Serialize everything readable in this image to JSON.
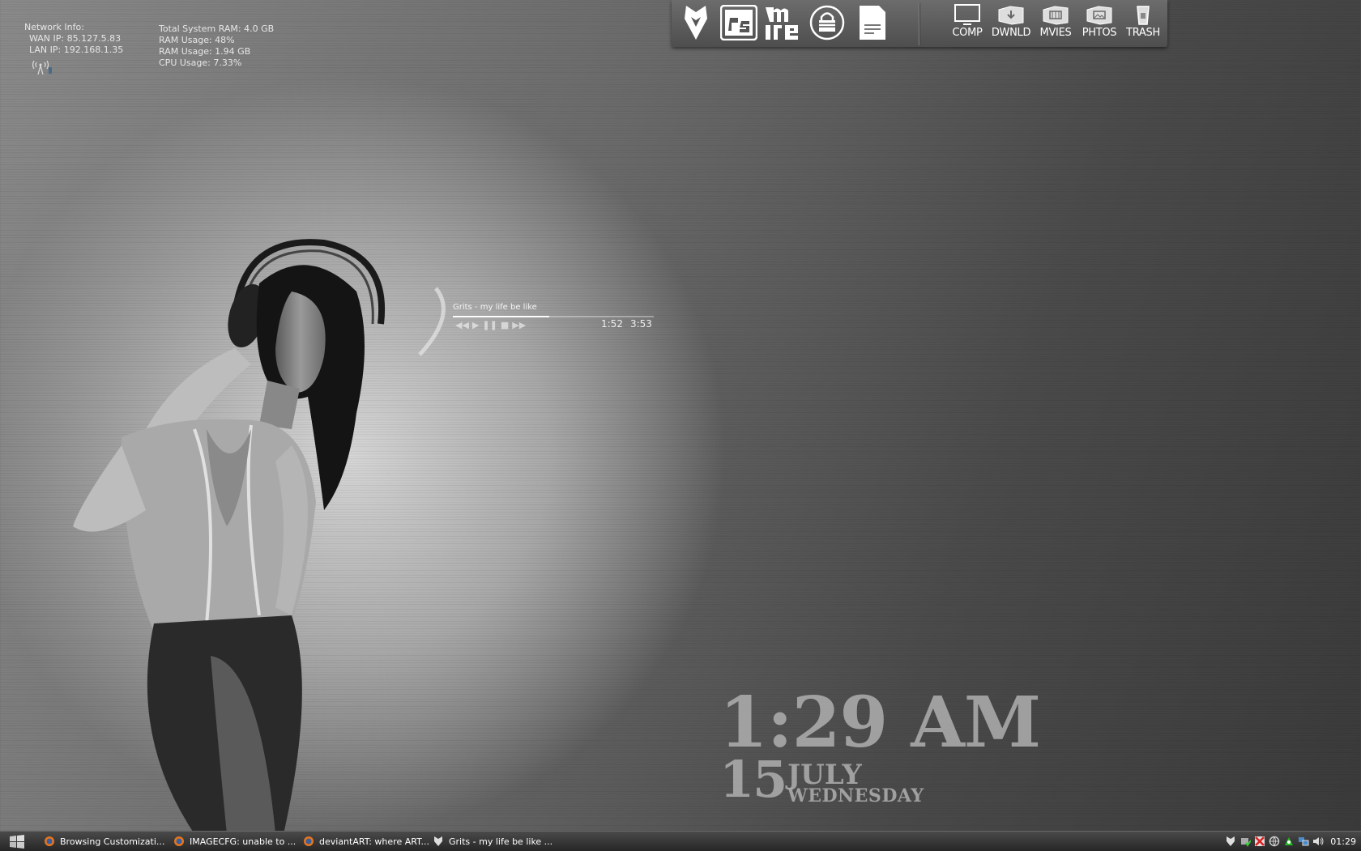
{
  "network": {
    "heading": "Network Info:",
    "wan": "WAN IP:  85.127.5.83",
    "lan": "LAN IP:  192.168.1.35"
  },
  "system": {
    "total_ram": "Total System RAM: 4.0 GB",
    "ram_pct": "RAM Usage: 48%",
    "ram_gb": "RAM Usage: 1.94 GB",
    "cpu": "CPU Usage: 7.33%"
  },
  "dock": {
    "folders": [
      {
        "label": "COMP"
      },
      {
        "label": "DWNLD"
      },
      {
        "label": "MVIES"
      },
      {
        "label": "PHTOS"
      },
      {
        "label": "TRASH"
      }
    ]
  },
  "player": {
    "track": "Grits - my life be like",
    "elapsed": "1:52",
    "total": "3:53",
    "progress": 0.48
  },
  "clock": {
    "time": "1:29 AM",
    "day": "15",
    "month": "JULY",
    "weekday": "WEDNESDAY"
  },
  "taskbar": {
    "tasks": [
      {
        "label": "Browsing Customizati..."
      },
      {
        "label": "IMAGECFG: unable to ..."
      },
      {
        "label": "deviantART: where ART..."
      },
      {
        "label": "Grits - my life be like    ..."
      }
    ],
    "clock": "01:29"
  }
}
